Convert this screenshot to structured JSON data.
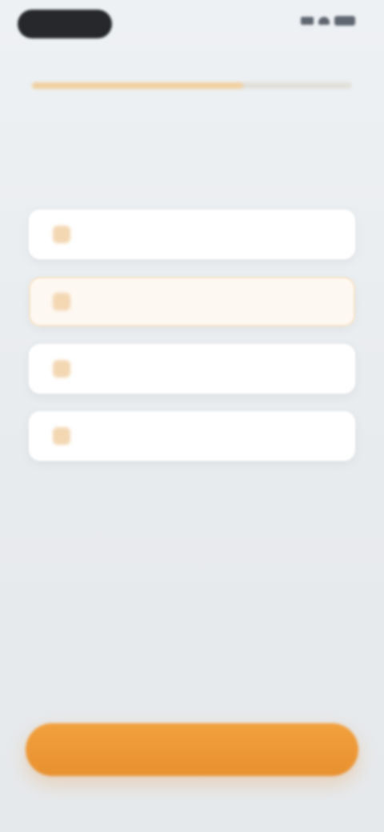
{
  "status_bar": {
    "time": ""
  },
  "progress": {
    "fraction": 0.66
  },
  "question": {
    "text": ""
  },
  "options": [
    {
      "label": "",
      "icon": "option-icon",
      "selected": false
    },
    {
      "label": "",
      "icon": "option-icon",
      "selected": true
    },
    {
      "label": "",
      "icon": "option-icon",
      "selected": false
    },
    {
      "label": "",
      "icon": "option-icon",
      "selected": false
    }
  ],
  "continue_button": {
    "label": ""
  },
  "colors": {
    "accent": "#E8902F",
    "accent_light": "#F0CF9D",
    "background": "#E9ECEF",
    "selected_option_bg": "#FDF8F1"
  }
}
